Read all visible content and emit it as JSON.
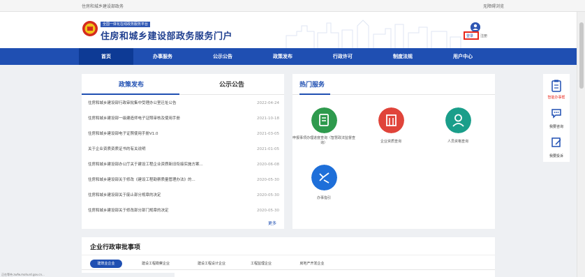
{
  "topbar": {
    "left_text": "住房和城乡建设部政务",
    "right_text": "无障碍浏览"
  },
  "header": {
    "slogan": "全国一体化在线政务服务平台",
    "title": "住房和城乡建设部政务服务门户",
    "login": "登录",
    "register": "注册"
  },
  "nav": {
    "items": [
      {
        "label": "首页"
      },
      {
        "label": "办事服务"
      },
      {
        "label": "公示公告"
      },
      {
        "label": "政策发布"
      },
      {
        "label": "行政许可"
      },
      {
        "label": "制度法规"
      },
      {
        "label": "用户中心"
      }
    ]
  },
  "news": {
    "tabs": [
      {
        "label": "政策发布"
      },
      {
        "label": "公示公告"
      }
    ],
    "rows": [
      {
        "title": "住房和城乡建设部行政审批集中受理办公室迁址公告",
        "date": "2022-04-24"
      },
      {
        "title": "住房和城乡建设部一级建造师电子证照审核及使用手册",
        "date": "2021-10-18"
      },
      {
        "title": "住房和城乡建设部电子证照使用手册V1.0",
        "date": "2021-03-05"
      },
      {
        "title": "关于企业资质资质证书的有关说明",
        "date": "2021-01-05"
      },
      {
        "title": "住房和城乡建设部办公厅关于建设工程企业资质新旧衔接实施方案...",
        "date": "2020-06-08"
      },
      {
        "title": "住房和城乡建设部关于修改《建设工程勘察质量管理办法》的...",
        "date": "2020-05-30"
      },
      {
        "title": "住房和城乡建设部关于废止部分规章的决定",
        "date": "2020-05-30"
      },
      {
        "title": "住房和城乡建设部关于修改部分部门规章的决定",
        "date": "2020-05-30"
      }
    ],
    "more": "更多"
  },
  "services": {
    "title": "热门服务",
    "items": [
      {
        "label": "申报事项办理进度查询（智慧政法监督查询）",
        "color": "#2e9a4d",
        "icon": "document-icon"
      },
      {
        "label": "企业资质查询",
        "color": "#e0443a",
        "icon": "building-icon"
      },
      {
        "label": "人员资格查询",
        "color": "#1a9e8a",
        "icon": "person-icon"
      },
      {
        "label": "办事指引",
        "color": "#1e6fd9",
        "icon": "guide-icon"
      }
    ]
  },
  "sidebar": {
    "items": [
      {
        "label": "智能办事帮",
        "red": true
      },
      {
        "label": "我要咨询",
        "red": false
      },
      {
        "label": "我要投诉",
        "red": false
      }
    ]
  },
  "section": {
    "title": "企业行政审批事项",
    "tabs": [
      {
        "label": "建筑业企业"
      },
      {
        "label": "建设工程勘察企业"
      },
      {
        "label": "建设工程设计企业"
      },
      {
        "label": "工程监理企业"
      },
      {
        "label": "房地产开发企业"
      }
    ]
  },
  "status_text": "正在等待 zwfw.mohurd.gov.cn...",
  "colors": {
    "brand_blue": "#1f4fb2",
    "nav_active": "#0d3a95",
    "highlight_red": "#e8271b"
  }
}
